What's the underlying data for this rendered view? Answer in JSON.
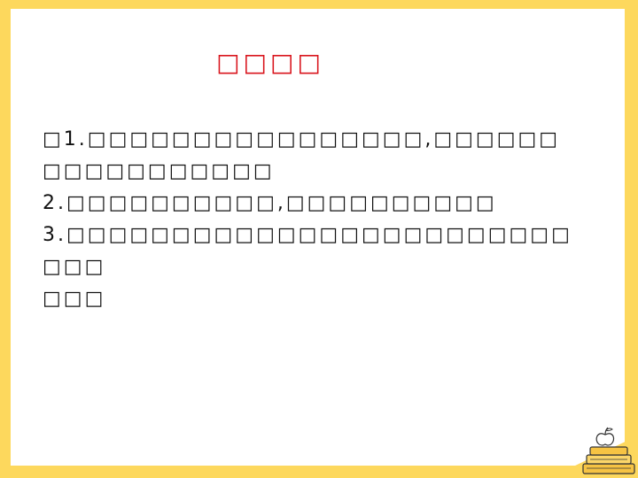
{
  "slide": {
    "title": "□□□□",
    "lines": [
      "□1.□□□□□□□□□□□□□□□□,□□□□□□",
      "□□□□□□□□□□□",
      "2.□□□□□□□□□□,□□□□□□□□□□",
      "3.□□□□□□□□□□□□□□□□□□□□□□□□",
      "□□□",
      "□□□"
    ]
  },
  "colors": {
    "border": "#fdd85d",
    "title": "#d9141c",
    "text": "#111111"
  },
  "icons": [
    "books-apple-icon"
  ]
}
